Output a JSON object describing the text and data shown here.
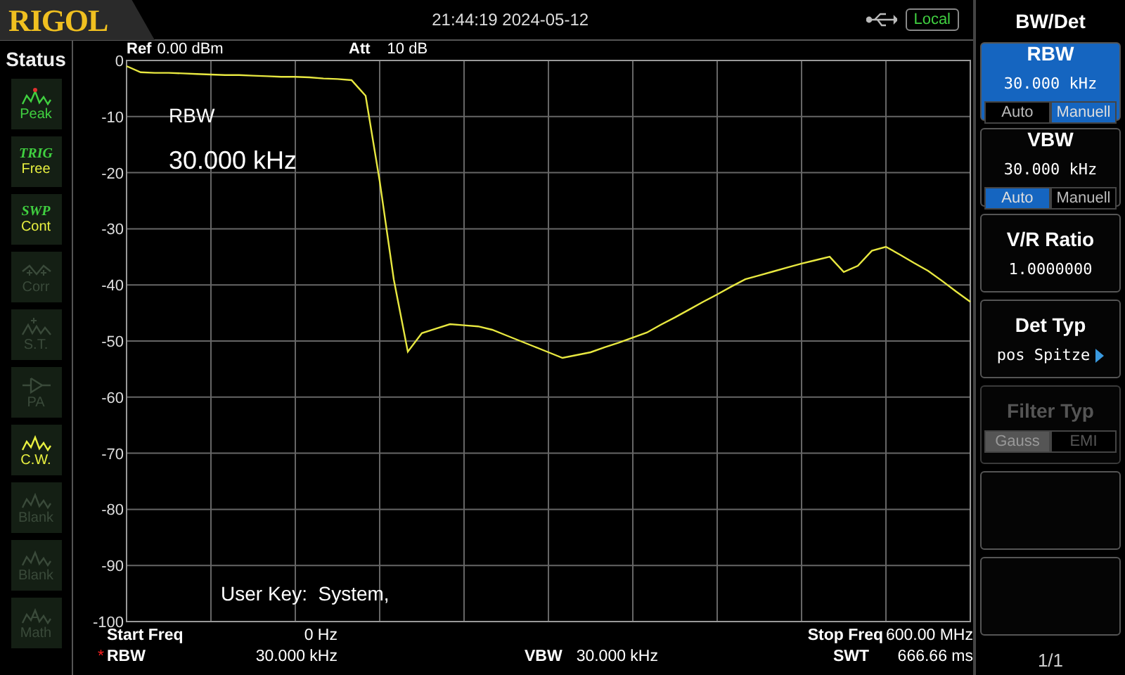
{
  "header": {
    "logo": "RIGOL",
    "datetime": "21:44:19 2024-05-12",
    "remote": "Local"
  },
  "status": {
    "title": "Status",
    "items": [
      {
        "kind": "peak",
        "label": "Peak",
        "active": true
      },
      {
        "kind": "text",
        "tag": "TRIG",
        "label": "Free",
        "active": true
      },
      {
        "kind": "text",
        "tag": "SWP",
        "label": "Cont",
        "active": true
      },
      {
        "kind": "corr",
        "label": "Corr",
        "active": false
      },
      {
        "kind": "st",
        "label": "S.T.",
        "active": false
      },
      {
        "kind": "pa",
        "label": "PA",
        "active": false
      },
      {
        "kind": "cw",
        "label": "C.W.",
        "active": true
      },
      {
        "kind": "wave",
        "label": "Blank",
        "active": false
      },
      {
        "kind": "wave",
        "label": "Blank",
        "active": false
      },
      {
        "kind": "math",
        "label": "Math",
        "active": false
      }
    ]
  },
  "trace": {
    "ref_label": "Ref",
    "ref_value": "0.00 dBm",
    "att_label": "Att",
    "att_value": "10 dB",
    "annotation_title": "RBW",
    "annotation_value": "30.000 kHz",
    "user_key": "User Key:  System,",
    "chart_data": {
      "type": "line",
      "categories": [
        null,
        null,
        null,
        null,
        null,
        null,
        null,
        null,
        null,
        null,
        null,
        null,
        null,
        null,
        null,
        null,
        null,
        null,
        null,
        null,
        null,
        null,
        null,
        null,
        null,
        null,
        null,
        null,
        null,
        null,
        null,
        null,
        null,
        null,
        null,
        null,
        null,
        null,
        null,
        null,
        null,
        null,
        null,
        null,
        null,
        null,
        null,
        null,
        null,
        null,
        null,
        null,
        null,
        null,
        null,
        null,
        null,
        null,
        null,
        null,
        null
      ],
      "series": [
        {
          "color": "#e8e840",
          "values": [
            -1,
            -2.1,
            -2.2,
            -2.2,
            -2.3,
            -2.4,
            -2.5,
            -2.6,
            -2.6,
            -2.7,
            -2.8,
            -2.9,
            -2.9,
            -3,
            -3.2,
            -3.3,
            -3.5,
            -6.3,
            -21.5,
            -39,
            -51.9,
            -48.6,
            -47.8,
            -47,
            -47.2,
            -47.4,
            -48,
            -49,
            -50,
            -51,
            -52,
            -53,
            -52.5,
            -52,
            -51.1,
            -50.3,
            -49.4,
            -48.5,
            -47.1,
            -45.8,
            -44.4,
            -43,
            -41.7,
            -40.3,
            -39,
            -38.3,
            -37.6,
            -36.9,
            -36.2,
            -35.6,
            -35,
            -37.7,
            -36.6,
            -33.9,
            -33.2,
            -34.6,
            -36.1,
            -37.5,
            -39.3,
            -41.2,
            -43
          ]
        }
      ],
      "grid": true,
      "ylim": [
        -100,
        0
      ],
      "yticks": [
        0,
        -10,
        -20,
        -30,
        -40,
        -50,
        -60,
        -70,
        -80,
        -90,
        -100
      ]
    }
  },
  "footer": {
    "start_label": "Start Freq",
    "start_value": "0 Hz",
    "stop_label": "Stop Freq",
    "stop_value": "600.00 MHz",
    "rbw_mark": "*",
    "rbw_label": "RBW",
    "rbw_value": "30.000 kHz",
    "vbw_label": "VBW",
    "vbw_value": "30.000 kHz",
    "swt_label": "SWT",
    "swt_value": "666.66 ms"
  },
  "menu": {
    "title": "BW/Det",
    "page": "1/1",
    "keys": [
      {
        "kind": "toggle",
        "label": "RBW",
        "value": "30.000 kHz",
        "selected": true,
        "disabled": false,
        "options": [
          {
            "label": "Auto",
            "selected": false
          },
          {
            "label": "Manuell",
            "selected": true
          }
        ]
      },
      {
        "kind": "toggle",
        "label": "VBW",
        "value": "30.000 kHz",
        "selected": false,
        "disabled": false,
        "options": [
          {
            "label": "Auto",
            "selected": true
          },
          {
            "label": "Manuell",
            "selected": false
          }
        ]
      },
      {
        "kind": "value",
        "label": "V/R Ratio",
        "value": "1.0000000",
        "selected": false,
        "disabled": false
      },
      {
        "kind": "submenu",
        "label": "Det Typ",
        "value": "pos Spitze",
        "selected": false,
        "disabled": false
      },
      {
        "kind": "toggle",
        "label": "Filter Typ",
        "selected": false,
        "disabled": true,
        "options": [
          {
            "label": "Gauss",
            "selected": true
          },
          {
            "label": "EMI",
            "selected": false
          }
        ]
      },
      {
        "kind": "empty",
        "selected": false
      },
      {
        "kind": "empty",
        "selected": false
      }
    ]
  }
}
